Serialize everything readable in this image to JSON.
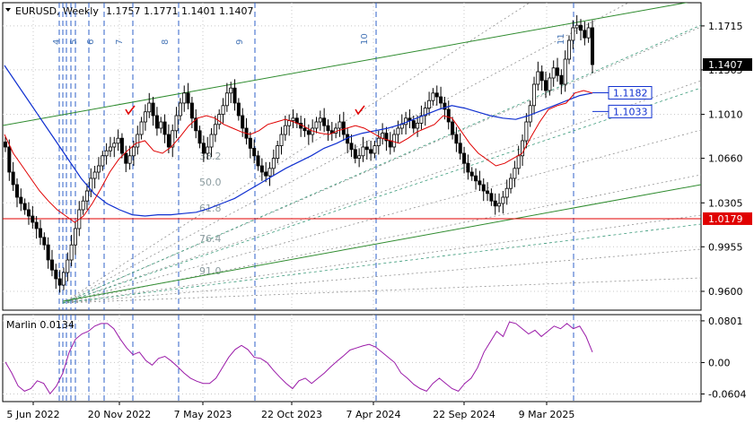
{
  "header": {
    "title": "EURUSD, Weekly",
    "ohlc": "1.1757 1.1771 1.1401 1.1407"
  },
  "indicator": {
    "label": "Marlin 0.0134",
    "ticks": [
      "0.0801",
      "0.00",
      "-0.0604"
    ]
  },
  "chart_data": [
    {
      "type": "candlestick",
      "title": "EURUSD, Weekly",
      "ylim": [
        0.945,
        1.19
      ],
      "y_ticks": [
        0.96,
        0.9955,
        1.0305,
        1.066,
        1.101,
        1.1365,
        1.1715
      ],
      "y_tick_labels": [
        "0.9600",
        "0.9955",
        "1.0305",
        "1.0660",
        "1.1010",
        "1.1365",
        "1.1715"
      ],
      "x_tick_labels": [
        "5 Jun 2022",
        "20 Nov 2022",
        "7 May 2023",
        "22 Oct 2023",
        "7 Apr 2024",
        "22 Sep 2024",
        "9 Mar 2025"
      ],
      "price_labels": [
        {
          "text": "1.1407",
          "value": 1.1407,
          "style": "current"
        },
        {
          "text": "1.1182",
          "value": 1.1182,
          "style": "boxed"
        },
        {
          "text": "1.1033",
          "value": 1.1033,
          "style": "boxed"
        },
        {
          "text": "1.0179",
          "value": 1.0179,
          "style": "level"
        }
      ],
      "horizontal_level": 1.0179,
      "fib_levels": [
        "38.2",
        "50.0",
        "61.8",
        "76.4",
        "91.0"
      ],
      "time_cycle_labels": [
        "4",
        "5",
        "6",
        "7",
        "8",
        "9",
        "10",
        "11"
      ],
      "weekly_close_path": [
        1.075,
        1.055,
        1.045,
        1.035,
        1.03,
        1.025,
        1.02,
        1.015,
        1.01,
        1.003,
        0.997,
        0.985,
        0.977,
        0.97,
        0.965,
        0.975,
        0.985,
        0.997,
        1.01,
        1.025,
        1.032,
        1.04,
        1.05,
        1.055,
        1.06,
        1.068,
        1.072,
        1.075,
        1.078,
        1.082,
        1.07,
        1.062,
        1.068,
        1.075,
        1.085,
        1.095,
        1.103,
        1.11,
        1.1,
        1.09,
        1.095,
        1.085,
        1.075,
        1.088,
        1.1,
        1.11,
        1.118,
        1.11,
        1.098,
        1.088,
        1.078,
        1.07,
        1.075,
        1.085,
        1.093,
        1.101,
        1.108,
        1.118,
        1.122,
        1.11,
        1.1,
        1.09,
        1.082,
        1.074,
        1.068,
        1.06,
        1.055,
        1.052,
        1.058,
        1.066,
        1.076,
        1.085,
        1.092,
        1.096,
        1.098,
        1.094,
        1.09,
        1.088,
        1.085,
        1.09,
        1.095,
        1.098,
        1.092,
        1.088,
        1.086,
        1.09,
        1.095,
        1.085,
        1.078,
        1.073,
        1.066,
        1.068,
        1.075,
        1.073,
        1.07,
        1.076,
        1.082,
        1.086,
        1.08,
        1.075,
        1.085,
        1.09,
        1.093,
        1.098,
        1.096,
        1.09,
        1.094,
        1.1,
        1.106,
        1.112,
        1.118,
        1.115,
        1.11,
        1.105,
        1.095,
        1.085,
        1.078,
        1.07,
        1.062,
        1.055,
        1.052,
        1.048,
        1.045,
        1.04,
        1.038,
        1.032,
        1.028,
        1.03,
        1.035,
        1.042,
        1.05,
        1.058,
        1.068,
        1.08,
        1.095,
        1.108,
        1.125,
        1.135,
        1.128,
        1.12,
        1.13,
        1.138,
        1.132,
        1.125,
        1.145,
        1.16,
        1.17,
        1.172,
        1.168,
        1.162,
        1.17,
        1.1407
      ],
      "ma_red_path": [
        1.085,
        1.07,
        1.06,
        1.05,
        1.04,
        1.032,
        1.025,
        1.02,
        1.015,
        1.02,
        1.03,
        1.042,
        1.055,
        1.065,
        1.072,
        1.078,
        1.08,
        1.072,
        1.07,
        1.075,
        1.083,
        1.092,
        1.098,
        1.1,
        1.098,
        1.093,
        1.09,
        1.087,
        1.085,
        1.088,
        1.093,
        1.095,
        1.097,
        1.095,
        1.092,
        1.088,
        1.086,
        1.085,
        1.088,
        1.09,
        1.092,
        1.09,
        1.086,
        1.082,
        1.08,
        1.078,
        1.082,
        1.087,
        1.09,
        1.093,
        1.1,
        1.098,
        1.088,
        1.078,
        1.07,
        1.065,
        1.06,
        1.062,
        1.066,
        1.07,
        1.083,
        1.095,
        1.105,
        1.108,
        1.11,
        1.118,
        1.12,
        1.118
      ],
      "ma_blue_path": [
        1.14,
        1.125,
        1.11,
        1.095,
        1.08,
        1.065,
        1.05,
        1.038,
        1.03,
        1.025,
        1.021,
        1.02,
        1.021,
        1.021,
        1.022,
        1.023,
        1.026,
        1.03,
        1.034,
        1.04,
        1.046,
        1.052,
        1.058,
        1.063,
        1.068,
        1.074,
        1.078,
        1.083,
        1.086,
        1.088,
        1.09,
        1.093,
        1.097,
        1.101,
        1.105,
        1.108,
        1.106,
        1.103,
        1.1,
        1.098,
        1.097,
        1.1,
        1.104,
        1.108,
        1.112,
        1.116,
        1.118
      ]
    },
    {
      "type": "line",
      "series": [
        {
          "name": "Marlin",
          "values": [
            0.001,
            -0.02,
            -0.045,
            -0.055,
            -0.05,
            -0.035,
            -0.04,
            -0.06,
            -0.045,
            -0.02,
            0.02,
            0.045,
            0.055,
            0.06,
            0.07,
            0.075,
            0.075,
            0.065,
            0.045,
            0.028,
            0.015,
            0.02,
            0.004,
            -0.005,
            0.008,
            0.012,
            0.003,
            -0.008,
            -0.02,
            -0.03,
            -0.036,
            -0.04,
            -0.04,
            -0.03,
            -0.01,
            0.01,
            0.025,
            0.033,
            0.025,
            0.01,
            0.008,
            0.0,
            -0.015,
            -0.028,
            -0.04,
            -0.05,
            -0.035,
            -0.03,
            -0.04,
            -0.03,
            -0.02,
            -0.008,
            0.003,
            0.013,
            0.024,
            0.028,
            0.032,
            0.035,
            0.03,
            0.02,
            0.01,
            0.0,
            -0.02,
            -0.03,
            -0.042,
            -0.05,
            -0.055,
            -0.04,
            -0.03,
            -0.04,
            -0.05,
            -0.055,
            -0.04,
            -0.03,
            -0.01,
            0.02,
            0.04,
            0.06,
            0.05,
            0.078,
            0.075,
            0.065,
            0.055,
            0.062,
            0.05,
            0.06,
            0.07,
            0.065,
            0.075,
            0.065,
            0.07,
            0.05,
            0.02
          ]
        }
      ],
      "ylim": [
        -0.075,
        0.092
      ],
      "y_ticks": [
        0.0801,
        0.0,
        -0.0604
      ]
    }
  ]
}
